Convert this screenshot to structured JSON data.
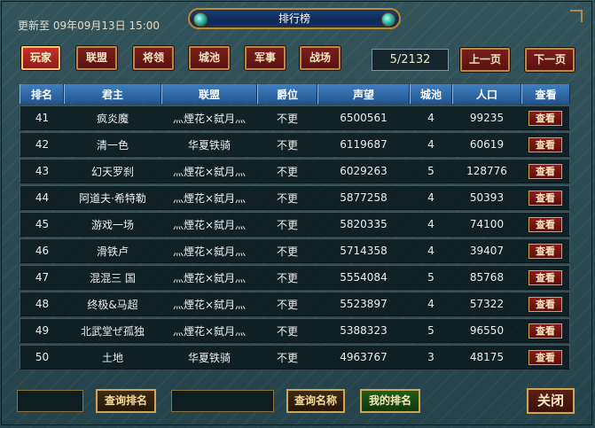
{
  "update_text": "更新至 09年09月13日 15:00",
  "title": "排行榜",
  "tabs": [
    {
      "label": "玩家",
      "active": true
    },
    {
      "label": "联盟",
      "active": false
    },
    {
      "label": "将领",
      "active": false
    },
    {
      "label": "城池",
      "active": false
    },
    {
      "label": "军事",
      "active": false
    },
    {
      "label": "战场",
      "active": false
    }
  ],
  "pagination": {
    "current": "5/2132",
    "prev_label": "上一页",
    "next_label": "下一页"
  },
  "table": {
    "headers": [
      "排名",
      "君主",
      "联盟",
      "爵位",
      "声望",
      "城池",
      "人口",
      "查看"
    ],
    "view_label": "查看",
    "rows": [
      {
        "rank": "41",
        "lord": "疯炎魔",
        "alliance": "灬煙花×弑月灬",
        "title": "不更",
        "prestige": "6500561",
        "cities": "4",
        "population": "99235"
      },
      {
        "rank": "42",
        "lord": "清一色",
        "alliance": "华夏铁骑",
        "title": "不更",
        "prestige": "6119687",
        "cities": "4",
        "population": "60619"
      },
      {
        "rank": "43",
        "lord": "幻天罗刹",
        "alliance": "灬煙花×弑月灬",
        "title": "不更",
        "prestige": "6029263",
        "cities": "5",
        "population": "128776"
      },
      {
        "rank": "44",
        "lord": "阿道夫·希特勒",
        "alliance": "灬煙花×弑月灬",
        "title": "不更",
        "prestige": "5877258",
        "cities": "4",
        "population": "50393"
      },
      {
        "rank": "45",
        "lord": "游戏一场",
        "alliance": "灬煙花×弑月灬",
        "title": "不更",
        "prestige": "5820335",
        "cities": "4",
        "population": "74100"
      },
      {
        "rank": "46",
        "lord": "滑铁卢",
        "alliance": "灬煙花×弑月灬",
        "title": "不更",
        "prestige": "5714358",
        "cities": "4",
        "population": "39407"
      },
      {
        "rank": "47",
        "lord": "混混三 国",
        "alliance": "灬煙花×弑月灬",
        "title": "不更",
        "prestige": "5554084",
        "cities": "5",
        "population": "85768"
      },
      {
        "rank": "48",
        "lord": "终极&马超",
        "alliance": "灬煙花×弑月灬",
        "title": "不更",
        "prestige": "5523897",
        "cities": "4",
        "population": "57322"
      },
      {
        "rank": "49",
        "lord": "北武堂ぜ孤独",
        "alliance": "灬煙花×弑月灬",
        "title": "不更",
        "prestige": "5388323",
        "cities": "5",
        "population": "96550"
      },
      {
        "rank": "50",
        "lord": "土地",
        "alliance": "华夏铁骑",
        "title": "不更",
        "prestige": "4963767",
        "cities": "3",
        "population": "48175"
      }
    ]
  },
  "bottom": {
    "query_rank_label": "查询排名",
    "query_name_label": "查询名称",
    "my_rank_label": "我的排名",
    "close_label": "关闭"
  },
  "colors": {
    "accent_gold": "#b58a3e",
    "button_red": "#7a1e1a",
    "header_blue": "#3f7fbf"
  }
}
